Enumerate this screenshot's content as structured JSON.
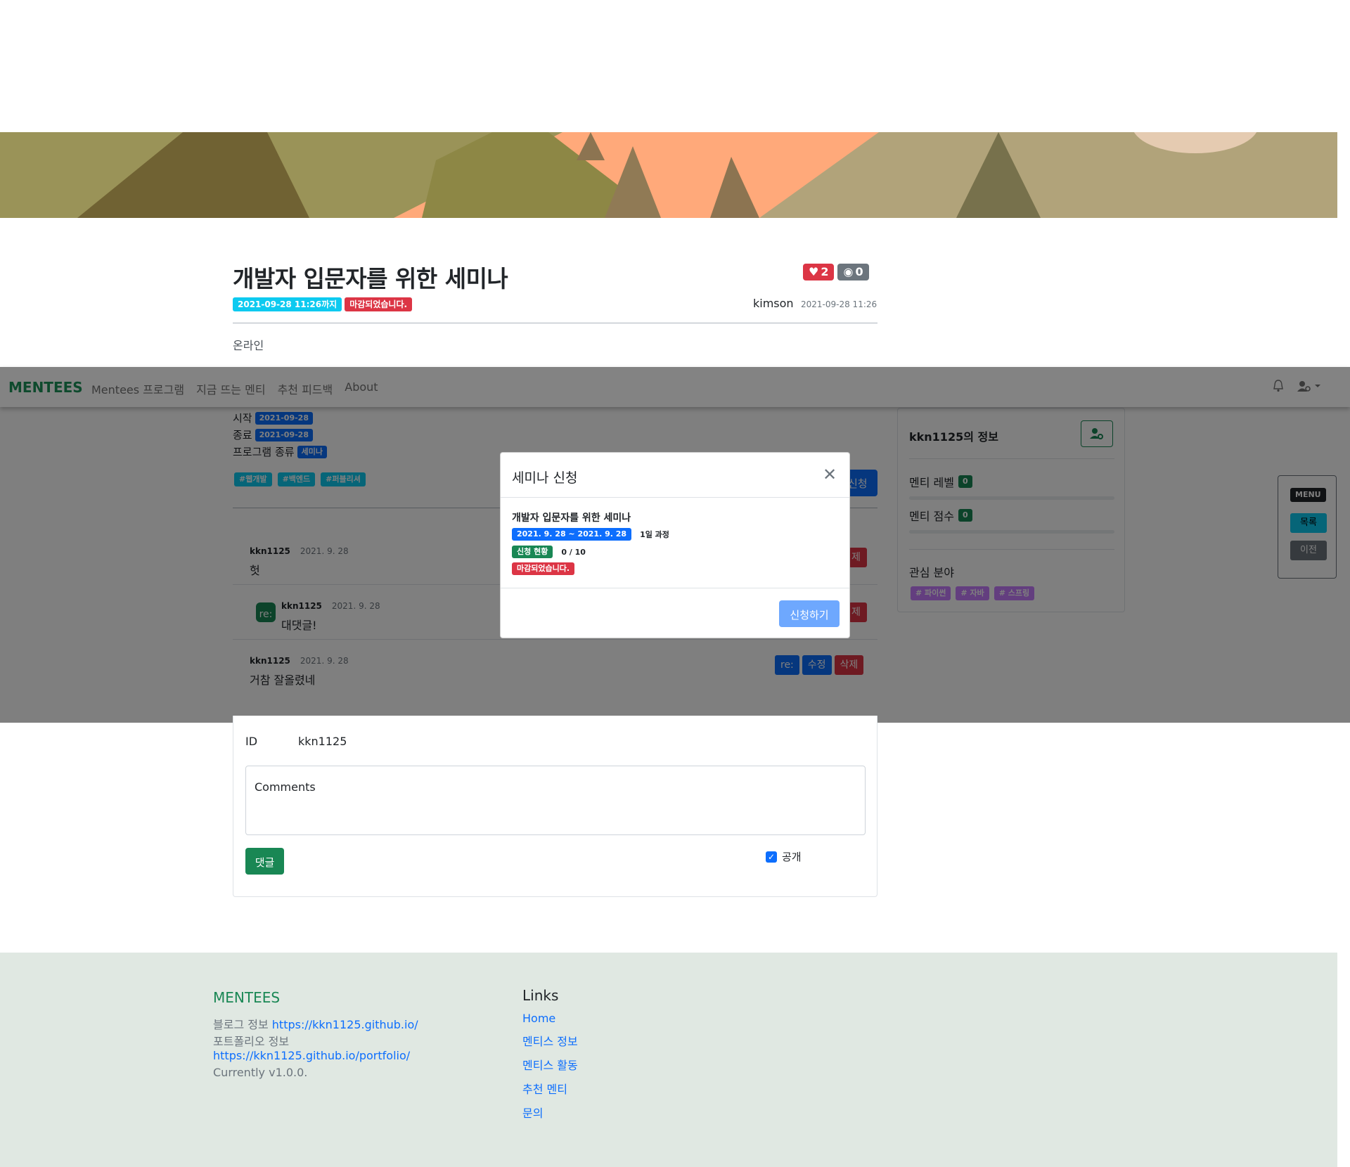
{
  "post": {
    "title": "개발자 입문자를 위한 세미나",
    "deadline_badge": "2021-09-28 11:26까지",
    "closed_badge": "마감되었습니다.",
    "likes": "2",
    "views": "0",
    "author": "kimson",
    "date": "2021-09-28 11:26",
    "mode": "온라인"
  },
  "navbar": {
    "brand": "MENTEES",
    "links": [
      "Mentees 프로그램",
      "지금 뜨는 멘티",
      "추천 피드백",
      "About"
    ]
  },
  "program": {
    "start_label": "시작",
    "start_date": "2021-09-28",
    "end_label": "종료",
    "end_date": "2021-09-28",
    "type_label": "프로그램 종류",
    "type_value": "세미나",
    "tags": [
      "#웹개발",
      "#백엔드",
      "#퍼블리셔"
    ],
    "apply_label": "신청"
  },
  "comments": [
    {
      "author": "kkn1125",
      "date": "2021. 9. 28",
      "text": "헛",
      "reply": false
    },
    {
      "author": "kkn1125",
      "date": "2021. 9. 28",
      "text": "대댓글!",
      "reply": true,
      "reply_icon": "re:"
    },
    {
      "author": "kkn1125",
      "date": "2021. 9. 28",
      "text": "거참 잘올렸네",
      "reply": false
    }
  ],
  "comment_actions": {
    "reply": "re:",
    "edit": "수정",
    "delete": "삭제",
    "delete_clipped": "제"
  },
  "sidebar": {
    "title": "kkn1125의 정보",
    "level_label": "멘티 레벨",
    "level_value": "0",
    "score_label": "멘티 점수",
    "score_value": "0",
    "interest_label": "관심 분야",
    "interests": [
      "# 파이썬",
      "# 자바",
      "# 스프링"
    ]
  },
  "float_menu": {
    "title": "MENU",
    "list": "목록",
    "prev": "이전"
  },
  "modal": {
    "title": "세미나 신청",
    "course": "개발자 입문자를 위한 세미나",
    "period": "2021. 9. 28 ~ 2021. 9. 28",
    "duration": "1일 과정",
    "status_label": "신청 현황",
    "status_value": "0 / 10",
    "closed": "마감되었습니다.",
    "submit": "신청하기"
  },
  "comment_form": {
    "id_label": "ID",
    "id_value": "kkn1125",
    "placeholder": "Comments",
    "submit": "댓글",
    "public_label": "공개"
  },
  "footer": {
    "brand": "MENTEES",
    "blog_label": "블로그 정보",
    "blog_url": "https://kkn1125.github.io/",
    "portfolio_label": "포트폴리오 정보",
    "portfolio_url": "https://kkn1125.github.io/portfolio/",
    "version": "Currently v1.0.0.",
    "links_heading": "Links",
    "links": [
      "Home",
      "멘티스 정보",
      "멘티스 활동",
      "추천 멘티",
      "문의"
    ]
  },
  "colors": {
    "primary": "#0d6efd",
    "success": "#198754",
    "danger": "#dc3545",
    "info": "#0dcaf0",
    "footer_bg": "#e0e8e2"
  }
}
